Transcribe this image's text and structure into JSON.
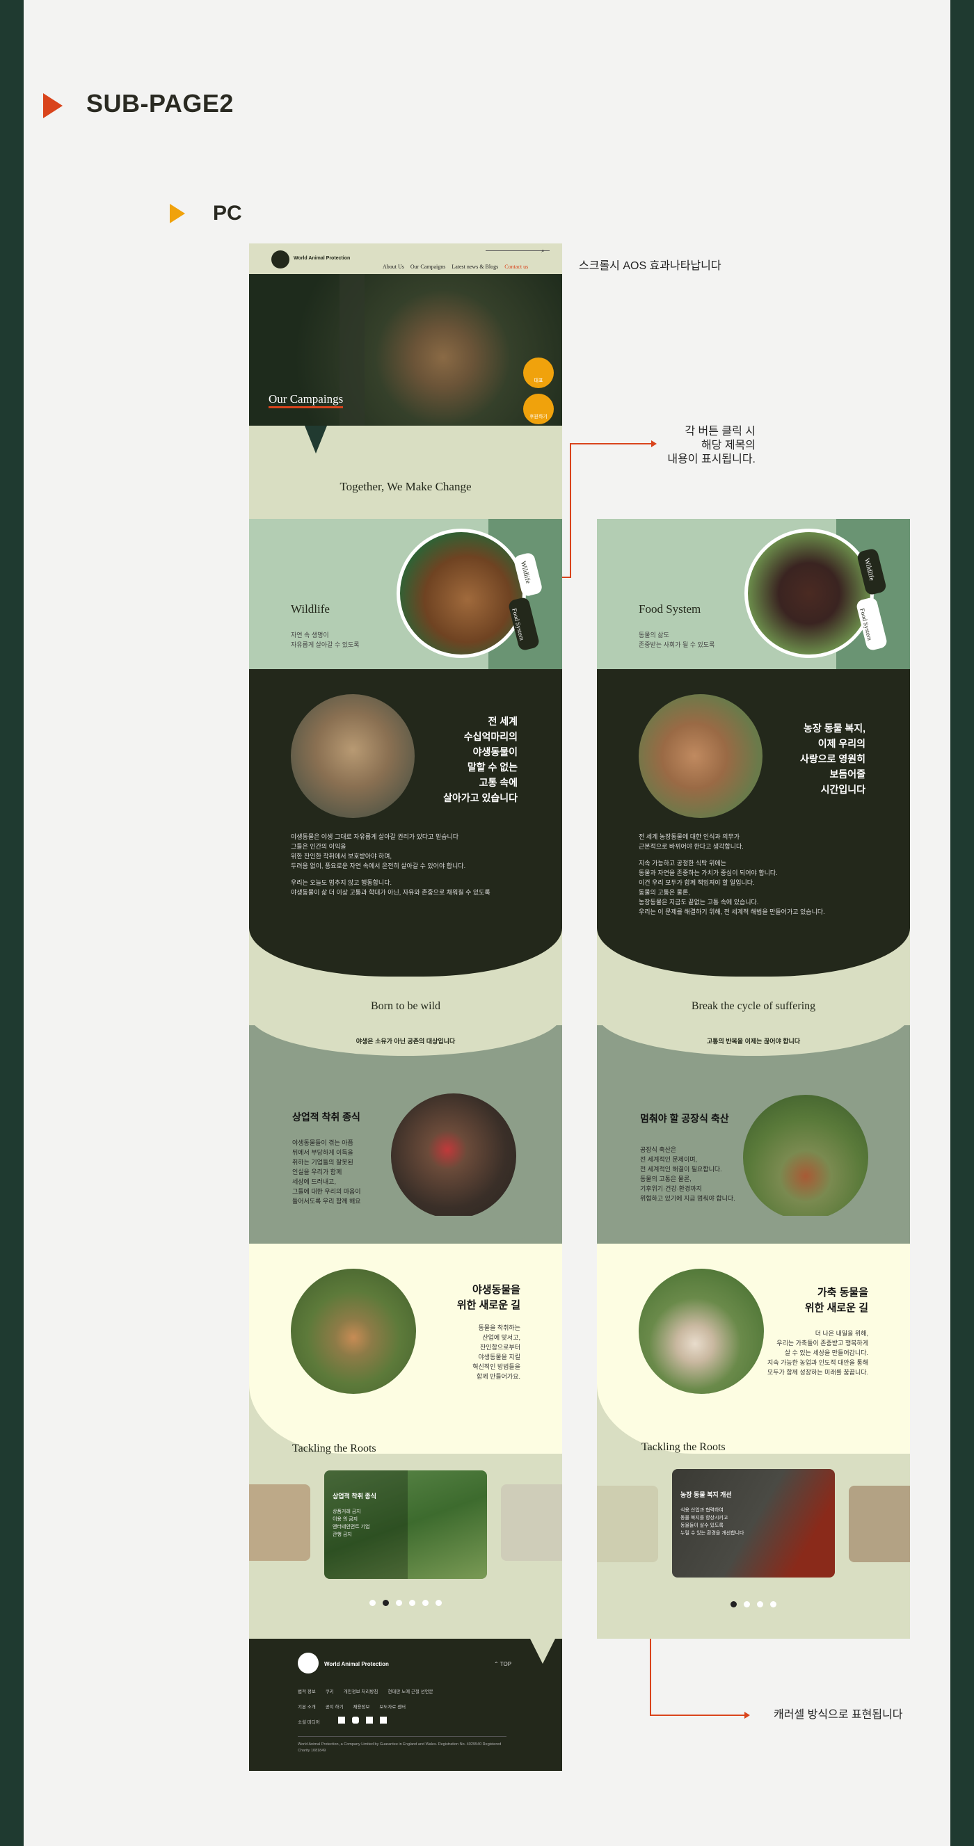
{
  "page": {
    "title": "SUB-PAGE2",
    "section": "PC"
  },
  "notes": {
    "aos": "스크롤시 AOS 효과나타납니다",
    "tab_click": [
      "각 버튼 클릭 시",
      "해당 제목의",
      "내용이 표시됩니다."
    ],
    "carousel": "캐러셀 방식으로 표현됩니다"
  },
  "header": {
    "logo": "World Animal Protection",
    "nav": [
      "About Us",
      "Our Campaigns",
      "Latest news & Blogs",
      "Contact us"
    ]
  },
  "hero": {
    "title": "Our Campaings",
    "floating_buttons": [
      "대표",
      "후원하기"
    ]
  },
  "intro": {
    "title": "Together, We Make Change"
  },
  "tabs": [
    "Wildlife",
    "Food System"
  ],
  "col1": {
    "topic": {
      "title": "Wildlife",
      "desc": [
        "자연 속 생명이",
        "자유롭게 살아갈 수 있도록"
      ]
    },
    "statement": [
      "전 세계",
      "수십억마리의",
      "야생동물이",
      "말할 수 없는",
      "고통 속에",
      "살아가고 있습니다"
    ],
    "body": [
      "야생동물은 야생 그대로 자유롭게 살아갈 권리가 있다고 믿습니다",
      "그들은 인간의 이익을",
      "위한 잔인한 착취에서 보호받아야 하며,",
      "두려움 없이, 풍요로운 자연 속에서 온전히 살아갈 수 있어야 합니다.",
      "",
      "우리는 오늘도 멈추지 않고 행동합니다.",
      "야생동물이 삶 더 이상 고통과 학대가 아닌, 자유와 존중으로 채워질 수 있도록"
    ],
    "band": {
      "title": "Born to be wild",
      "subtitle": "야생은 소유가 아닌 공존의 대상입니다"
    },
    "issue": {
      "title": "상업적 착취 종식",
      "body": [
        "야생동물들이 겪는 아픔",
        "뒤에서 부당하게 이득을",
        "취하는 기업들의 잘못된",
        "인실을 우리가 함께",
        "세상에 드러내고,",
        "그들에 대한 우리의 마음이",
        "들어서도록 우리 함께 해요"
      ]
    },
    "solution": {
      "title": [
        "야생동물을",
        "위한 새로운 길"
      ],
      "body": [
        "동물을 착취하는",
        "산업에 맞서고,",
        "잔인함으로부터",
        "야생동물을 지킬",
        "혁신적인 방법들을",
        "함께 만들어가요."
      ]
    },
    "roots": {
      "title": "Tackling the Roots",
      "card_title": "상업적 착취 종식",
      "card_body": [
        "상품거래 금지",
        "이용 의 금지",
        "엔터테인먼트 기업",
        "관행 금지"
      ]
    },
    "dots": 6,
    "active_dot": 2
  },
  "col2": {
    "topic": {
      "title": "Food System",
      "desc": [
        "동물의 삶도",
        "존중받는 사회가 될 수 있도록"
      ]
    },
    "statement": [
      "농장 동물 복지,",
      "이제 우리의",
      "사랑으로 영원히",
      "보듬어줄",
      "시간입니다"
    ],
    "body": [
      "전 세계 농장동물에 대한 인식과 의무가",
      "근본적으로 바뀌어야 한다고 생각합니다.",
      "",
      "지속 가능하고 공정한 식탁 위에는",
      "동물과 자연을 존중하는 가치가 중심이 되어야 합니다.",
      "이건 우리 모두가 함께 책임져야 할 일입니다.",
      "동물의 고통은 물론,",
      "농장동물은 지금도 끝없는 고통 속에 있습니다.",
      "우리는 이 문제를 해결하기 위해, 전 세계적 해법을 만들어가고 있습니다."
    ],
    "band": {
      "title": "Break the cycle of suffering",
      "subtitle": "고통의 반복을 이제는 끊어야 합니다"
    },
    "issue": {
      "title": "멈춰야 할 공장식 축산",
      "body": [
        "공장식 축산은",
        "전 세계적인 문제이며,",
        "전 세계적인 해결이 필요합니다.",
        "동물의 고통은 물론,",
        "기후위기·건강·환경까지",
        "위협하고 있기에 지금 멈춰야 합니다."
      ]
    },
    "solution": {
      "title": [
        "가축 동물을",
        "위한 새로운 길"
      ],
      "body": [
        "더 나은 내일을 위해,",
        "우리는 가축들이 존중받고 행복하게",
        "살 수 있는 세상을 만들어갑니다.",
        "지속 가능한 농업과 인도적 대안을 통해",
        "모두가 함께 성장하는 미래를 꿈꿉니다."
      ]
    },
    "roots": {
      "title": "Tackling the Roots",
      "card_title": "농장 동물 복지 개선",
      "card_body": [
        "식용 산업과 협력하여",
        "동물 복지를 향상시키고",
        "동물들이 살수 있도록",
        "누릴 수 있는 환경을 개선합니다"
      ]
    },
    "dots": 4,
    "active_dot": 1
  },
  "footer": {
    "logo": "World Animal Protection",
    "top": "TOP",
    "row1": [
      "법적 정보",
      "쿠키",
      "개인정보 처리방침",
      "현대판 노예 근절 선언문"
    ],
    "row2": [
      "기본 소개",
      "공지 하기",
      "채용정보",
      "보도자료 센터"
    ],
    "row3": "소셜 미디어",
    "copyright": "World Animal Protection, a Company Limited by Guarantee in England and Wales. Registration No. 4029540 Registered Charity 1081849"
  },
  "colors": {
    "accent": "#d9441c",
    "orange": "#f0a20c",
    "dark": "#23281b",
    "sage": "#8d9e89",
    "mint": "#b3cdb3",
    "cream": "#fdfde2",
    "beige": "#d9dec2"
  }
}
